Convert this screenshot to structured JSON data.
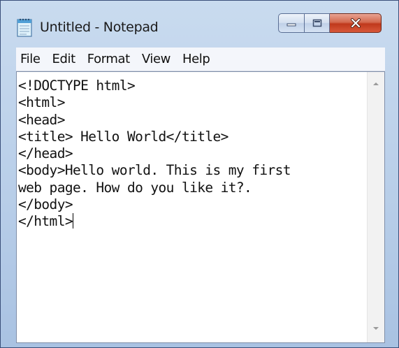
{
  "window": {
    "title": "Untitled - Notepad"
  },
  "menu": {
    "items": [
      "File",
      "Edit",
      "Format",
      "View",
      "Help"
    ]
  },
  "editor": {
    "lines": [
      "<!DOCTYPE html>",
      "<html>",
      "<head>",
      "<title> Hello World</title>",
      "</head>",
      "<body>Hello world. This is my first",
      "web page. How do you like it?.",
      "</body>",
      "</html>"
    ]
  },
  "icons": {
    "app": "notepad-icon",
    "minimize": "minimize-icon",
    "maximize": "maximize-icon",
    "close": "close-icon",
    "scroll_up": "scroll-up-arrow-icon",
    "scroll_down": "scroll-down-arrow-icon"
  },
  "colors": {
    "close_button": "#c0391c",
    "frame": "#b7cde8",
    "desktop": "#223aa8"
  }
}
